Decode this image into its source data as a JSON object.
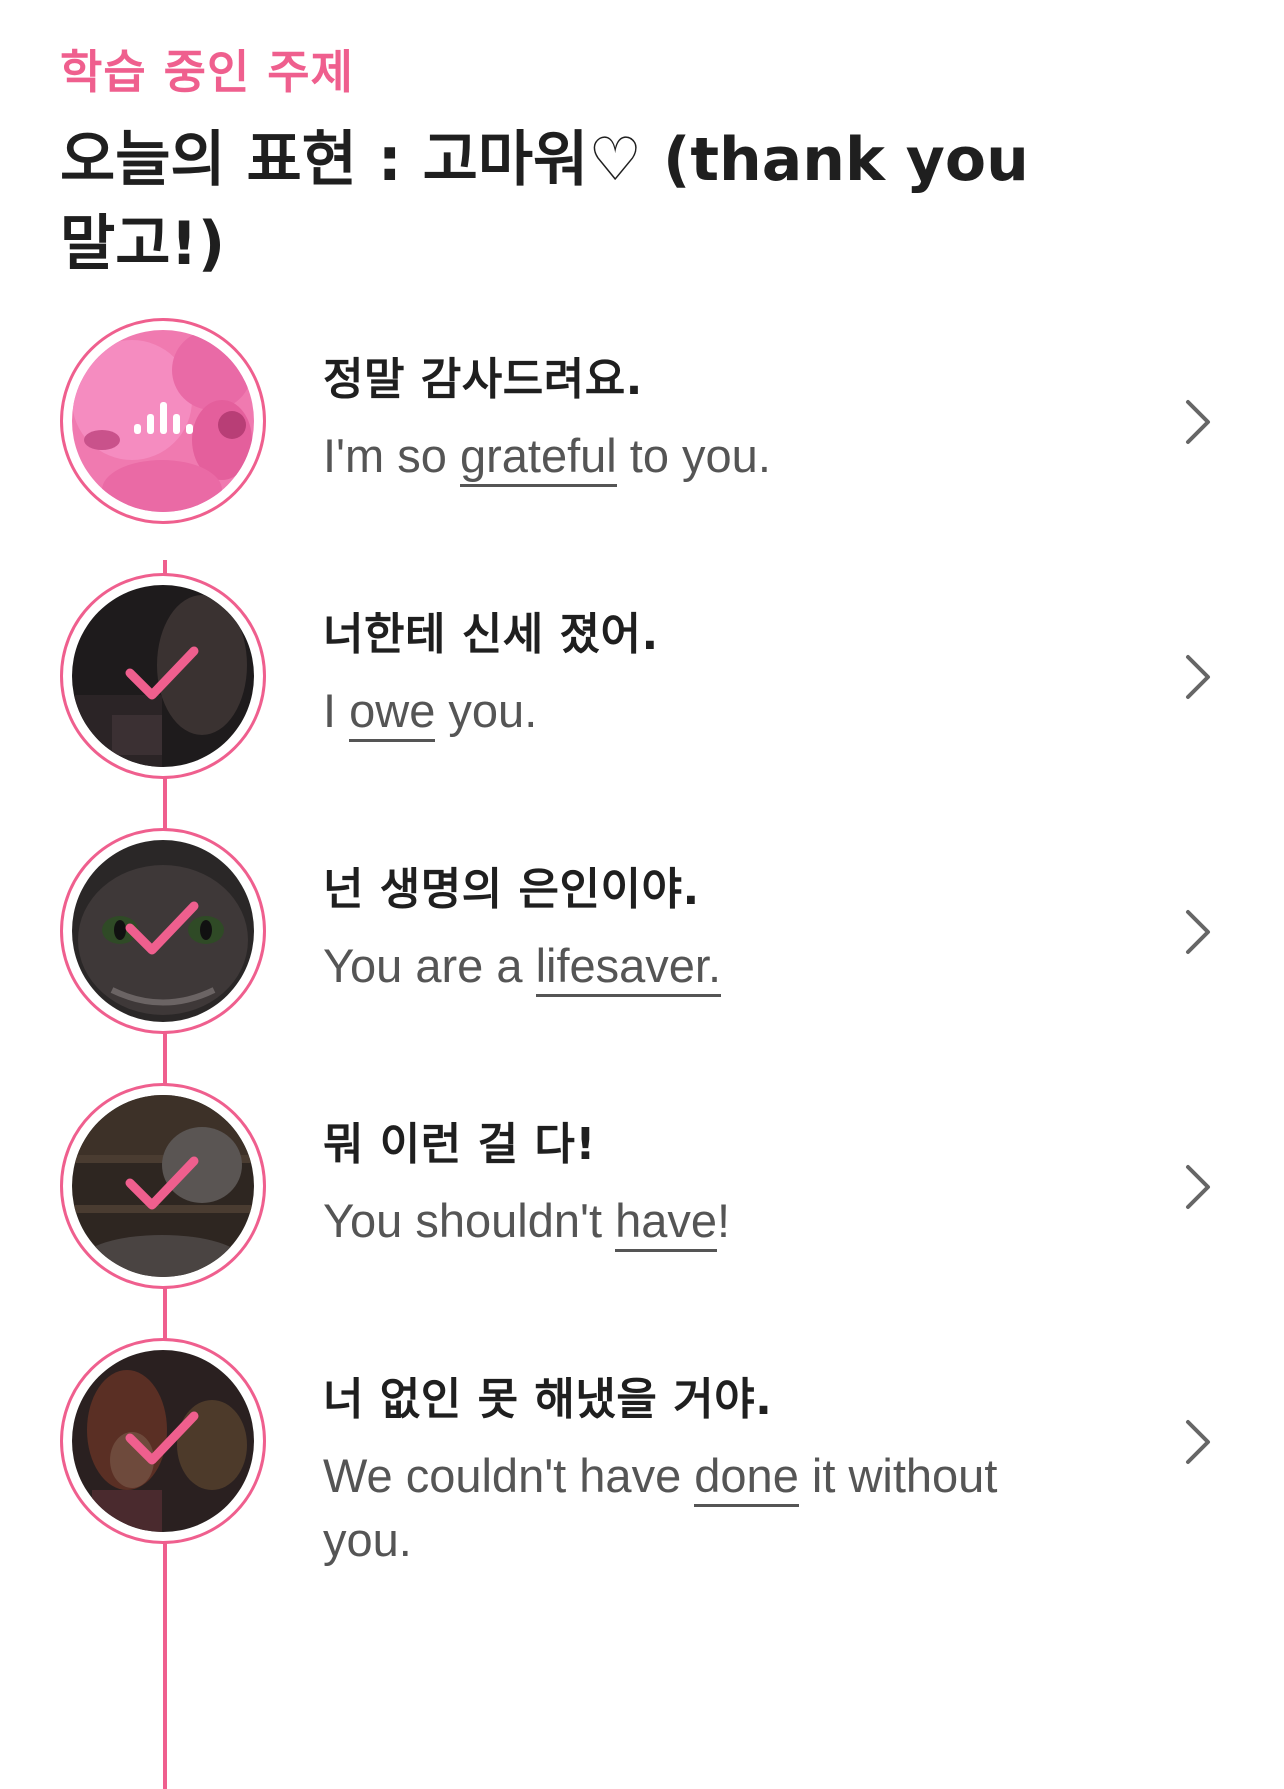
{
  "header": {
    "topic_label": "학습 중인 주제",
    "title": "오늘의 표현 : 고마워♡ (thank you 말고!)"
  },
  "colors": {
    "accent": "#ef5f8e",
    "text_primary": "#1f1f1f",
    "text_secondary": "#555555"
  },
  "lessons": [
    {
      "korean": "정말 감사드려요.",
      "english_before": "I'm so ",
      "english_keyword": "grateful",
      "english_after": " to you.",
      "status_icon": "audio-playing-icon"
    },
    {
      "korean": "너한테 신세 졌어.",
      "english_before": "I ",
      "english_keyword": "owe",
      "english_after": " you.",
      "status_icon": "check-icon"
    },
    {
      "korean": "넌 생명의 은인이야.",
      "english_before": "You are a ",
      "english_keyword": "lifesaver.",
      "english_after": "",
      "status_icon": "check-icon"
    },
    {
      "korean": "뭐 이런 걸 다!",
      "english_before": "You shouldn't ",
      "english_keyword": "have",
      "english_after": "!",
      "status_icon": "check-icon"
    },
    {
      "korean": "너 없인 못 해냈을 거야.",
      "english_before": "We couldn't have ",
      "english_keyword": "done",
      "english_after": " it without you.",
      "status_icon": "check-icon"
    }
  ],
  "icons": {
    "row_action": "chevron-right-icon"
  }
}
